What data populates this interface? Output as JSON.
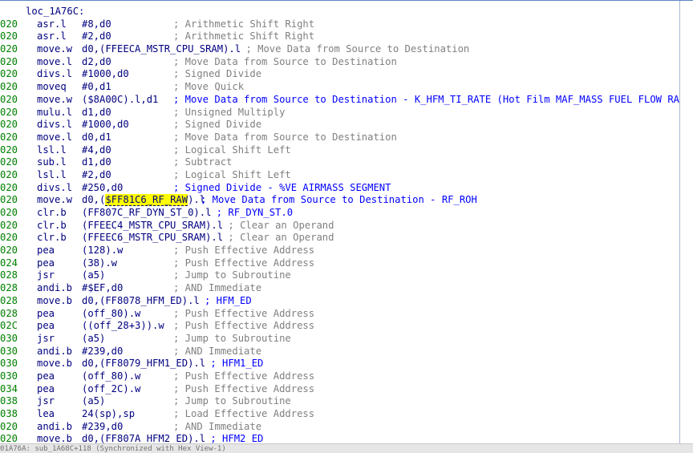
{
  "listing": {
    "label": "loc_1A76C:",
    "rows": [
      {
        "addr": "020",
        "mnem": "asr.l",
        "ops": "#8,d0",
        "comment": "; Arithmetic Shift Right",
        "style": "gray"
      },
      {
        "addr": "020",
        "mnem": "asr.l",
        "ops": "#2,d0",
        "comment": "; Arithmetic Shift Right",
        "style": "gray"
      },
      {
        "addr": "020",
        "mnem": "move.w",
        "ops": "d0,(FFEECA_MSTR_CPU_SRAM).l",
        "comment": "; Move Data from Source to Destination",
        "style": "gray"
      },
      {
        "addr": "020",
        "mnem": "move.l",
        "ops": "d2,d0",
        "comment": "; Move Data from Source to Destination",
        "style": "gray"
      },
      {
        "addr": "020",
        "mnem": "divs.l",
        "ops": "#1000,d0",
        "comment": "; Signed Divide",
        "style": "gray"
      },
      {
        "addr": "020",
        "mnem": "moveq",
        "ops": "#0,d1",
        "comment": "; Move Quick",
        "style": "gray"
      },
      {
        "addr": "020",
        "mnem": "move.w",
        "ops": "($8A00C).l,d1",
        "comment": "; Move Data from Source to Destination - K_HFM_TI_RATE (Hot Film MAF_MASS FUEL FLOW RATE)",
        "style": "blue"
      },
      {
        "addr": "020",
        "mnem": "mulu.l",
        "ops": "d1,d0",
        "comment": "; Unsigned Multiply",
        "style": "gray"
      },
      {
        "addr": "020",
        "mnem": "divs.l",
        "ops": "#1000,d0",
        "comment": "; Signed Divide",
        "style": "gray"
      },
      {
        "addr": "020",
        "mnem": "move.l",
        "ops": "d0,d1",
        "comment": "; Move Data from Source to Destination",
        "style": "gray"
      },
      {
        "addr": "020",
        "mnem": "lsl.l",
        "ops": "#4,d0",
        "comment": "; Logical Shift Left",
        "style": "gray"
      },
      {
        "addr": "020",
        "mnem": "sub.l",
        "ops": "d1,d0",
        "comment": "; Subtract",
        "style": "gray"
      },
      {
        "addr": "020",
        "mnem": "lsl.l",
        "ops": "#2,d0",
        "comment": "; Logical Shift Left",
        "style": "gray"
      },
      {
        "addr": "020",
        "mnem": "divs.l",
        "ops": "#250,d0",
        "comment": "; Signed Divide - %VE AIRMASS SEGMENT",
        "style": "blue"
      },
      {
        "addr": "020",
        "mnem": "move.w",
        "ops_pre": "d0,(",
        "ops_hl": "$FF81C6_RF_RAW",
        "ops_post": ").l",
        "comment": "; Move Data from Source to Destination - RF_ROH",
        "style": "blue"
      },
      {
        "addr": "020",
        "mnem": "clr.b",
        "ops": "(FF807C_RF_DYN_ST_0).l",
        "comment": "; RF_DYN_ST.0",
        "style": "blue"
      },
      {
        "addr": "020",
        "mnem": "clr.b",
        "ops": "(FFEEC4_MSTR_CPU_SRAM).l",
        "comment": "; Clear an Operand",
        "style": "gray"
      },
      {
        "addr": "020",
        "mnem": "clr.b",
        "ops": "(FFEEC6_MSTR_CPU_SRAM).l",
        "comment": "; Clear an Operand",
        "style": "gray"
      },
      {
        "addr": "020",
        "mnem": "pea",
        "ops": "(128).w",
        "comment": "; Push Effective Address",
        "style": "gray"
      },
      {
        "addr": "024",
        "mnem": "pea",
        "ops": "(38).w",
        "comment": "; Push Effective Address",
        "style": "gray"
      },
      {
        "addr": "028",
        "mnem": "jsr",
        "ops": "(a5)",
        "comment": "; Jump to Subroutine",
        "style": "gray"
      },
      {
        "addr": "028",
        "mnem": "andi.b",
        "ops": "#$EF,d0",
        "comment": "; AND Immediate",
        "style": "gray"
      },
      {
        "addr": "028",
        "mnem": "move.b",
        "ops": "d0,(FF8078_HFM_ED).l",
        "comment": "; HFM_ED",
        "style": "blue"
      },
      {
        "addr": "028",
        "mnem": "pea",
        "ops": "(off_80).w",
        "comment": "; Push Effective Address",
        "style": "gray"
      },
      {
        "addr": "02C",
        "mnem": "pea",
        "ops": "((off_28+3)).w",
        "comment": "; Push Effective Address",
        "style": "gray"
      },
      {
        "addr": "030",
        "mnem": "jsr",
        "ops": "(a5)",
        "comment": "; Jump to Subroutine",
        "style": "gray"
      },
      {
        "addr": "030",
        "mnem": "andi.b",
        "ops": "#239,d0",
        "comment": "; AND Immediate",
        "style": "gray"
      },
      {
        "addr": "030",
        "mnem": "move.b",
        "ops": "d0,(FF8079_HFM1_ED).l",
        "comment": "; HFM1_ED",
        "style": "blue"
      },
      {
        "addr": "030",
        "mnem": "pea",
        "ops": "(off_80).w",
        "comment": "; Push Effective Address",
        "style": "gray"
      },
      {
        "addr": "034",
        "mnem": "pea",
        "ops": "(off_2C).w",
        "comment": "; Push Effective Address",
        "style": "gray"
      },
      {
        "addr": "038",
        "mnem": "jsr",
        "ops": "(a5)",
        "comment": "; Jump to Subroutine",
        "style": "gray"
      },
      {
        "addr": "038",
        "mnem": "lea",
        "ops": "24(sp),sp",
        "comment": "; Load Effective Address",
        "style": "gray"
      },
      {
        "addr": "020",
        "mnem": "andi.b",
        "ops": "#239,d0",
        "comment": "; AND Immediate",
        "style": "gray"
      },
      {
        "addr": "020",
        "mnem": "move.b",
        "ops": "d0,(FF807A_HFM2_ED).l",
        "comment": "; HFM2_ED",
        "style": "blue"
      }
    ]
  },
  "status_bar": {
    "text": "01A76A: sub_1A68C+118 (Synchronized with Hex View-1)"
  },
  "colors": {
    "address": "#008000",
    "code": "#000080",
    "comment_gray": "#808080",
    "comment_blue": "#0000ff",
    "highlight": "#ffff00"
  }
}
